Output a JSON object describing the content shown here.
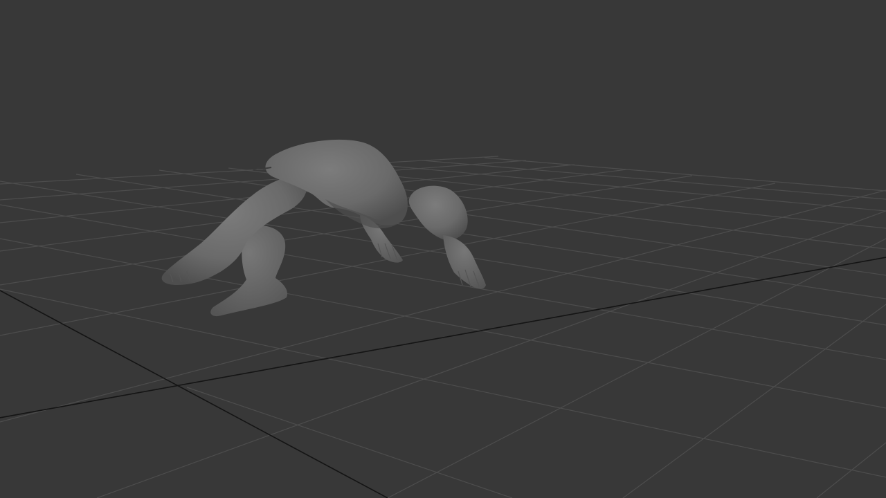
{
  "viewport": {
    "background_color": "#383838",
    "grid_line_color": "#4d4d4d",
    "grid_axis_color": "#141414",
    "model_color": "#6a6a6a",
    "model_shadow_color": "#4e4e4e",
    "model_highlight_color": "#7c7c7c",
    "grid_visible": true,
    "model_shading": "smooth-gray"
  }
}
